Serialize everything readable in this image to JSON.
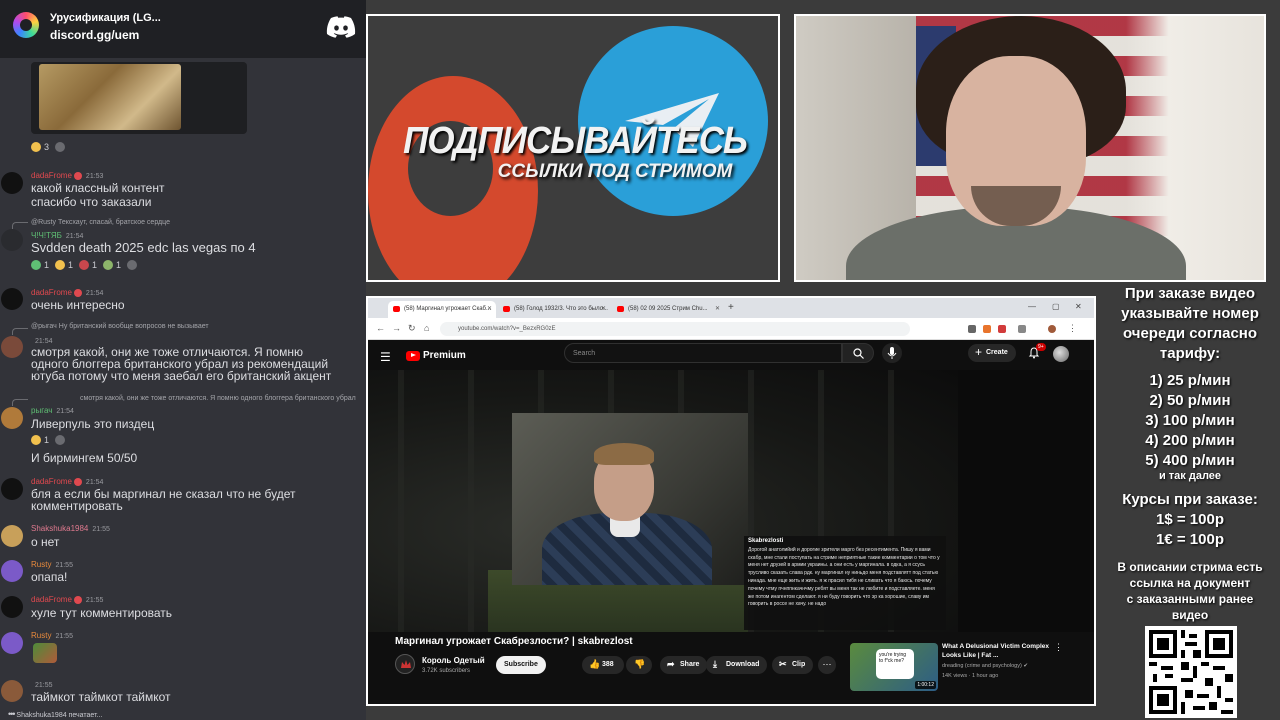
{
  "discord": {
    "server_title": "Урусификация (LG...",
    "invite": "discord.gg/uem",
    "top_reactions": [
      {
        "count": "3"
      }
    ],
    "messages": [
      {
        "user": "dadaFrome",
        "time": "21:53",
        "text": "какой классный контент"
      },
      {
        "text": "спасибо что заказали"
      },
      {
        "reply": "@Rusty Тексхаут, спасай, братское сердце",
        "user": "Ч!Ч!ТЯБ",
        "time": "21:54",
        "text": "Svdden death 2025 edc las vegas по 4",
        "reactions": [
          "1",
          "1",
          "1",
          "1"
        ]
      },
      {
        "user": "dadaFrome",
        "time": "21:54",
        "text": "очень интересно"
      },
      {
        "reply": "@рыгач Ну британский вообще вопросов не вызывает",
        "time": "21:54",
        "text": "смотря какой, они же тоже отличаются. Я помню",
        "text2": "одного блоггера британского убрал из рекомендаций",
        "text3": "ютуба потому что меня заебал его британский акцент"
      },
      {
        "reply": "смотря какой, они же тоже отличаются. Я помню одного блоггера британского убрал",
        "user": "рыгач",
        "time": "21:54",
        "text": "Ливерпуль это пиздец",
        "reactions": [
          "1"
        ]
      },
      {
        "text": "И бирмингем 50/50"
      },
      {
        "user": "dadaFrome",
        "time": "21:54",
        "text": "бля а если бы маргинал не сказал что не будет",
        "text2": "комментировать"
      },
      {
        "user": "Shakshuka1984",
        "time": "21:55",
        "text": "о нет"
      },
      {
        "user": "Rusty",
        "time": "21:55",
        "text": "опапа!"
      },
      {
        "user": "dadaFrome",
        "time": "21:55",
        "text": "хуле тут комментировать"
      },
      {
        "user": "Rusty",
        "time": "21:55"
      },
      {
        "time": "21:55",
        "text": "таймкот таймкот таймкот"
      }
    ],
    "typing": "Shakshuka1984 печатает..."
  },
  "promo": {
    "title": "ПОДПИСЫВАЙТЕСЬ",
    "subtitle": "ССЫЛКИ ПОД СТРИМОМ"
  },
  "browser": {
    "tabs": [
      "(58) Маргинал угрожает Скаб...",
      "(58) Голод 1932/3. Что это было...",
      "(58) 02 09 2025 Стрим Chu..."
    ],
    "url": "youtube.com/watch?v=_BezxRG0zE"
  },
  "youtube": {
    "logo": "Premium",
    "search_placeholder": "Search",
    "create": "Create",
    "notifications": "9+",
    "donation": {
      "name": "Skabrezlosti",
      "text": "Дорогой анатолийий и дорогие зрители марго без ресентимента. Пишу я вами скабр, мне стали поступать на стриме неприятные такие комментарии о том что у меня нет друзей в армии украины. а они есть у маргинала. в одка, а я ссусь трусливо сказать слава рдк. ну маргинал ну ниньдо меня подставлятт под статью нинада. мне еще жить и жить. я ж прасил тибя не сливать что я баюсь. почему почему чтму пчнппнкачнчму ребят вы меня так не любите и подставляете. меня же потом инагентом сделают. я ни буду говорить что эр ка хорошие, славу им говорить в россе не хачу. не надо"
    },
    "video_title": "Маргинал угрожает Скабрезлости? | skabrezlost",
    "channel": {
      "name": "Король Одетый",
      "subs": "3.72K subscribers"
    },
    "subscribe": "Subscribe",
    "actions": {
      "likes": "388",
      "share": "Share",
      "download": "Download",
      "clip": "Clip"
    },
    "recommended": {
      "thumb_text": "you're trying to f*ck me?",
      "duration": "1:00:12",
      "title": "What A Delusional Victim Complex Looks Like | Fat ...",
      "channel": "dreading (crime and psychology)",
      "meta": "14K views · 1 hour ago"
    }
  },
  "info": {
    "intro": [
      "При заказе видео",
      "указывайте номер",
      "очереди согласно",
      "тарифу:"
    ],
    "tariffs": [
      "1) 25 р/мин",
      "2) 50 р/мин",
      "3) 100 р/мин",
      "4) 200 р/мин",
      "5) 400 р/мин"
    ],
    "etc": "и так далее",
    "rates_title": "Курсы при заказе:",
    "rates": [
      "1$ = 100р",
      "1€ = 100р"
    ],
    "description": [
      "В описании стрима есть",
      "ссылка на документ",
      "с заказанными ранее",
      "видео"
    ]
  },
  "colors": {
    "discord_bg": "#323339",
    "youtube_red": "#ff0000",
    "promo_blue": "#2a9fd8",
    "promo_red": "#d4492d"
  }
}
